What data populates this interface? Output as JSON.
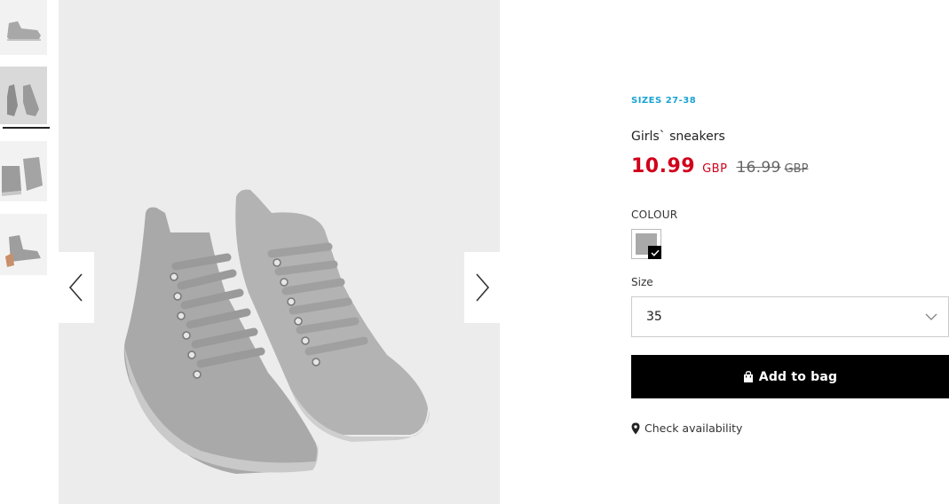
{
  "gallery": {
    "thumbnails": [
      {
        "alt": "",
        "selected": false
      },
      {
        "alt": "",
        "selected": true
      },
      {
        "alt": "",
        "selected": false
      },
      {
        "alt": "",
        "selected": false
      }
    ],
    "prev_icon": "chevron-left-icon",
    "next_icon": "chevron-right-icon"
  },
  "product": {
    "sizes_tag": "SIZES 27-38",
    "title": "Girls` sneakers",
    "price_new": "10.99",
    "price_new_currency": "GBP",
    "price_old": "16.99",
    "price_old_currency": "GBP",
    "colour_label": "COLOUR",
    "colour_swatch": "#a9a9a9",
    "size_label": "Size",
    "size_value": "35",
    "add_to_bag": "Add to bag",
    "check_availability": "Check availability"
  },
  "colors": {
    "accent_blue": "#1aa3d4",
    "sale_red": "#d0021b",
    "button_black": "#000000"
  }
}
